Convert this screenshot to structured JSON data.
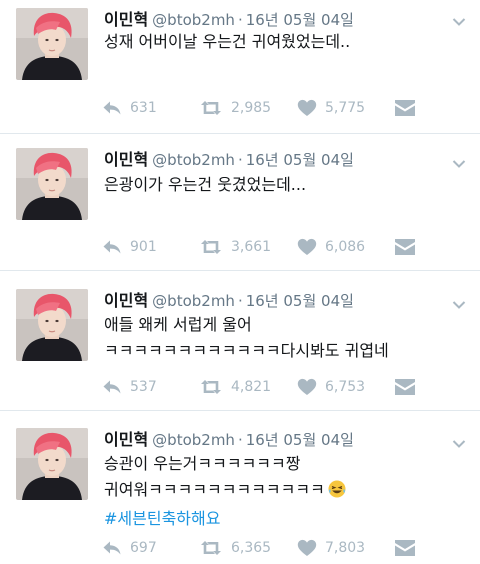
{
  "profile": {
    "display_name": "이민혁",
    "handle": "@btob2mh",
    "separator": "·",
    "date": "16년 05월 04일"
  },
  "icons": {
    "reply": "reply-icon",
    "retweet": "retweet-icon",
    "like": "heart-icon",
    "message": "direct-message-icon",
    "more": "chevron-down-icon"
  },
  "colors": {
    "action_gray": "#aab8c2",
    "text_gray": "#657786",
    "hashtag_blue": "#1b95e0",
    "divider": "#e1e8ed",
    "avatar_hair": "#e8566a"
  },
  "tweets": [
    {
      "lines": [
        "성재 어버이날 우는건 귀여웠었는데.."
      ],
      "replies": "631",
      "retweets": "2,985",
      "likes": "5,775"
    },
    {
      "lines": [
        "은광이가 우는건 웃겼었는데..."
      ],
      "replies": "901",
      "retweets": "3,661",
      "likes": "6,086"
    },
    {
      "lines": [
        "애들 왜케 서럽게 울어",
        "ㅋㅋㅋㅋㅋㅋㅋㅋㅋㅋㅋㅋ다시봐도 귀엽네"
      ],
      "replies": "537",
      "retweets": "4,821",
      "likes": "6,753"
    },
    {
      "lines": [
        "승관이 우는거ㅋㅋㅋㅋㅋㅋ짱",
        "귀여워ㅋㅋㅋㅋㅋㅋㅋㅋㅋㅋㅋㅋ"
      ],
      "emoji": "😂",
      "hashtag": "#세븐틴축하해요",
      "replies": "697",
      "retweets": "6,365",
      "likes": "7,803"
    }
  ]
}
